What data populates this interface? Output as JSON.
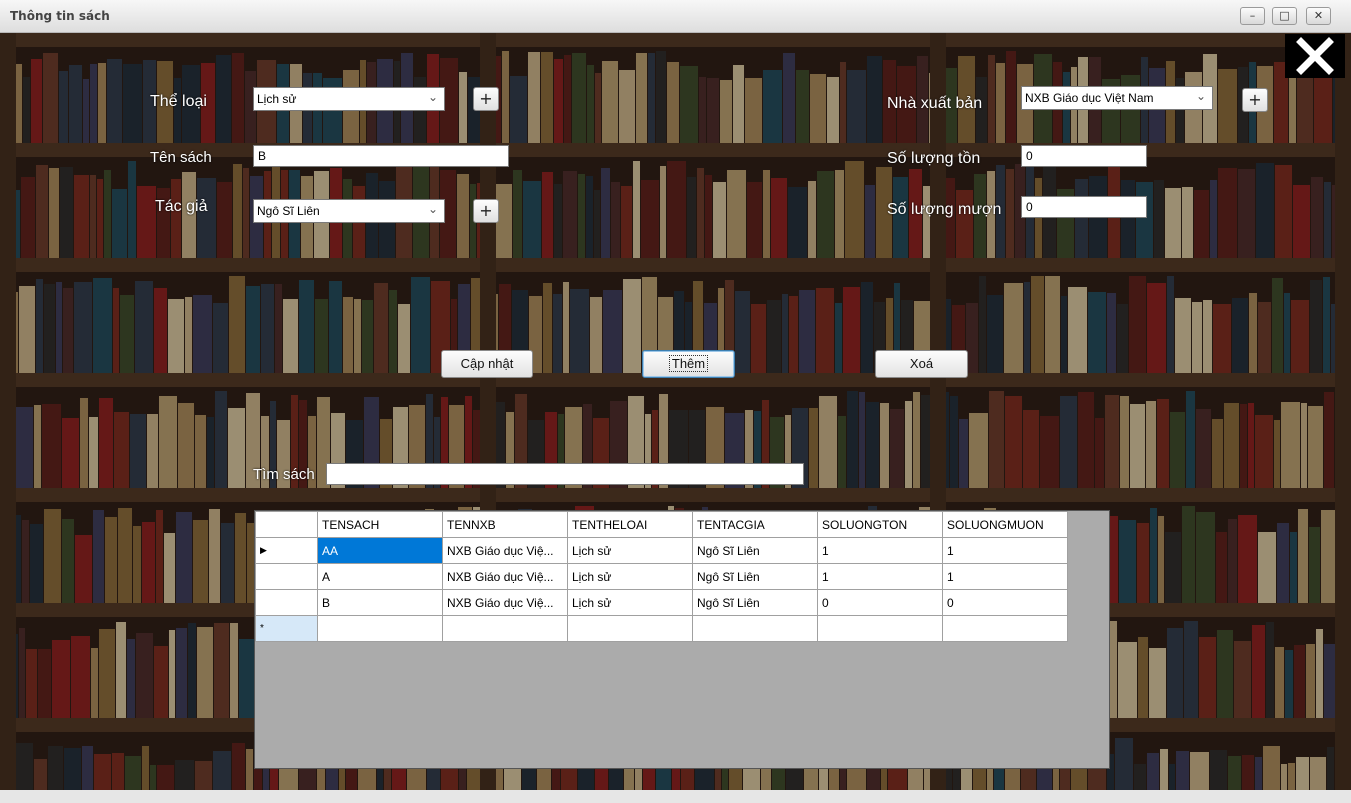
{
  "window": {
    "title": "Thông tin sách",
    "controls": [
      "–",
      "□",
      "✕"
    ]
  },
  "form": {
    "theloai_label": "Thể loại",
    "theloai_value": "Lịch sử",
    "tensach_label": "Tên sách",
    "tensach_value": "B",
    "tacgia_label": "Tác giả",
    "tacgia_value": "Ngô Sĩ Liên",
    "nxb_label": "Nhà xuất bản",
    "nxb_value": "NXB Giáo dục Việt Nam",
    "soluongton_label": "Số lượng tồn",
    "soluongton_value": "0",
    "soluongmuon_label": "Số lượng mượn",
    "soluongmuon_value": "0",
    "plus": "+",
    "search_label": "Tìm sách",
    "search_value": ""
  },
  "buttons": {
    "update": "Cập nhật",
    "add": "Thêm",
    "delete": "Xoá"
  },
  "grid": {
    "columns": [
      "TENSACH",
      "TENNXB",
      "TENTHELOAI",
      "TENTACGIA",
      "SOLUONGTON",
      "SOLUONGMUON"
    ],
    "rows": [
      [
        "AA",
        "NXB Giáo dục Việ...",
        "Lịch sử",
        "Ngô Sĩ Liên",
        "1",
        "1"
      ],
      [
        "A",
        "NXB Giáo dục Việ...",
        "Lịch sử",
        "Ngô Sĩ Liên",
        "1",
        "1"
      ],
      [
        "B",
        "NXB Giáo dục Việ...",
        "Lịch sử",
        "Ngô Sĩ Liên",
        "0",
        "0"
      ]
    ],
    "current_row_marker": "▶",
    "new_row_marker": "*"
  },
  "colors": {
    "selection": "#0078d7",
    "background": "#2a1c14"
  },
  "icons": {
    "close": "close-x-icon",
    "dropdown": "chevron-down-icon"
  }
}
